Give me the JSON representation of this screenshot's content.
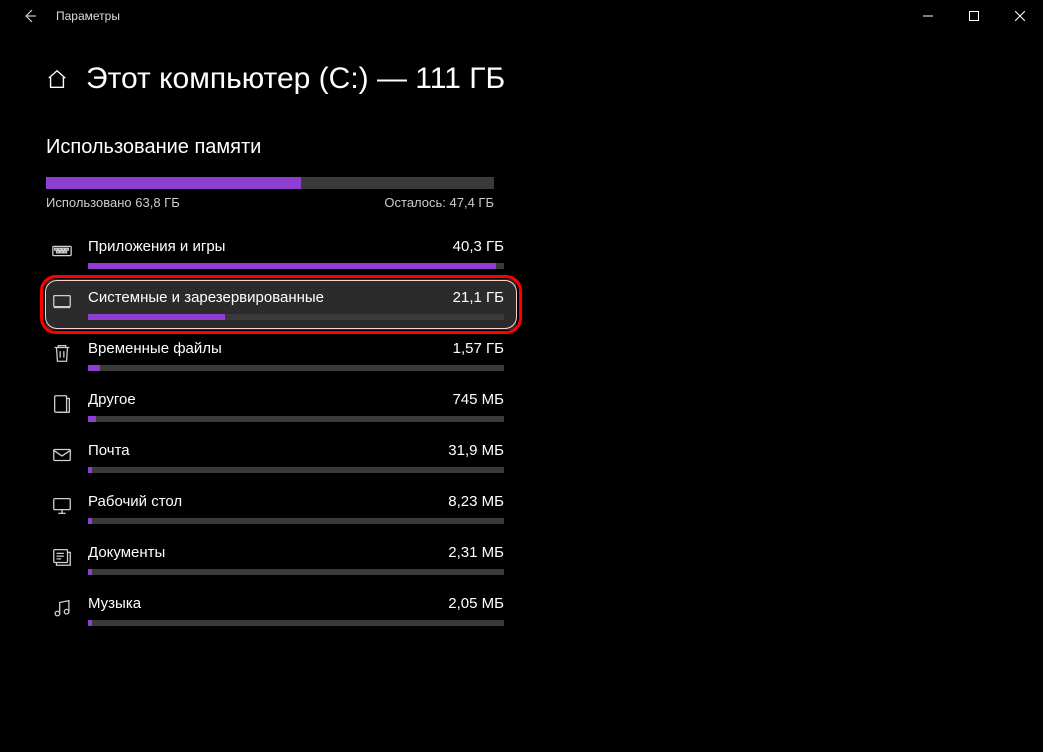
{
  "window": {
    "title": "Параметры"
  },
  "page": {
    "title": "Этот компьютер (C:) — 111 ГБ",
    "section_title": "Использование памяти"
  },
  "usage": {
    "used_label": "Использовано 63,8 ГБ",
    "free_label": "Осталось: 47,4 ГБ",
    "used_pct": 57
  },
  "categories": [
    {
      "icon": "apps",
      "name": "Приложения и игры",
      "size": "40,3 ГБ",
      "pct": 98,
      "hover": false,
      "highlight": false
    },
    {
      "icon": "system",
      "name": "Системные и зарезервированные",
      "size": "21,1 ГБ",
      "pct": 33,
      "hover": true,
      "highlight": true
    },
    {
      "icon": "trash",
      "name": "Временные файлы",
      "size": "1,57 ГБ",
      "pct": 3,
      "hover": false,
      "highlight": false
    },
    {
      "icon": "other",
      "name": "Другое",
      "size": "745 МБ",
      "pct": 2,
      "hover": false,
      "highlight": false
    },
    {
      "icon": "mail",
      "name": "Почта",
      "size": "31,9 МБ",
      "pct": 1,
      "hover": false,
      "highlight": false
    },
    {
      "icon": "desktop",
      "name": "Рабочий стол",
      "size": "8,23 МБ",
      "pct": 1,
      "hover": false,
      "highlight": false
    },
    {
      "icon": "document",
      "name": "Документы",
      "size": "2,31 МБ",
      "pct": 1,
      "hover": false,
      "highlight": false
    },
    {
      "icon": "music",
      "name": "Музыка",
      "size": "2,05 МБ",
      "pct": 1,
      "hover": false,
      "highlight": false
    }
  ]
}
